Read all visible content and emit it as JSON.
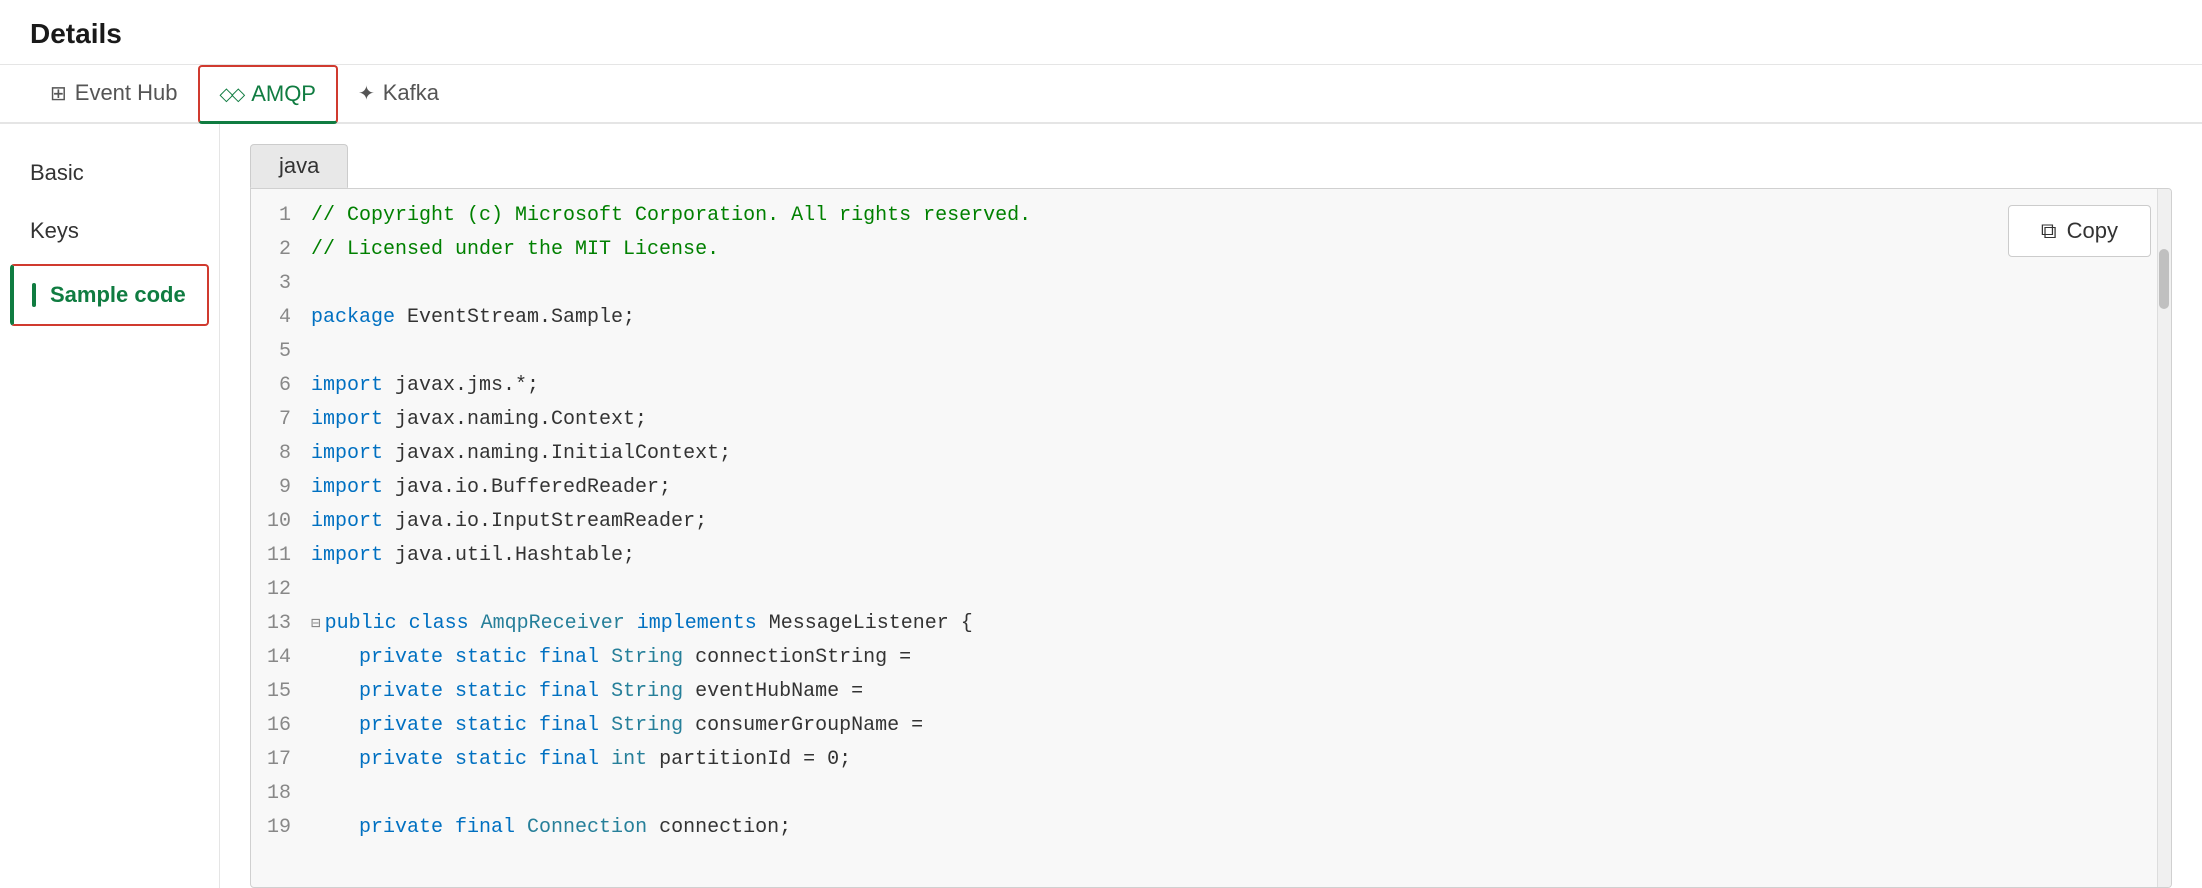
{
  "page": {
    "title": "Details"
  },
  "tabs": [
    {
      "id": "eventhub",
      "label": "Event Hub",
      "icon": "⊞",
      "active": false
    },
    {
      "id": "amqp",
      "label": "AMQP",
      "icon": "◇◇",
      "active": true,
      "bordered": true
    },
    {
      "id": "kafka",
      "label": "Kafka",
      "icon": "✦",
      "active": false
    }
  ],
  "sidebar": {
    "items": [
      {
        "id": "basic",
        "label": "Basic",
        "active": false
      },
      {
        "id": "keys",
        "label": "Keys",
        "active": false
      },
      {
        "id": "sample-code",
        "label": "Sample code",
        "active": true
      }
    ]
  },
  "code_panel": {
    "language_tab": "java",
    "copy_button_label": "Copy",
    "copy_icon": "⧉",
    "lines": [
      {
        "num": 1,
        "content": "// Copyright (c) Microsoft Corporation. All rights reserved.",
        "type": "comment"
      },
      {
        "num": 2,
        "content": "// Licensed under the MIT License.",
        "type": "comment"
      },
      {
        "num": 3,
        "content": "",
        "type": "text"
      },
      {
        "num": 4,
        "content": "package EventStream.Sample;",
        "type": "mixed",
        "parts": [
          {
            "text": "package ",
            "cls": "c-keyword"
          },
          {
            "text": "EventStream.Sample;",
            "cls": "c-text"
          }
        ]
      },
      {
        "num": 5,
        "content": "",
        "type": "text"
      },
      {
        "num": 6,
        "content": "import javax.jms.*;",
        "type": "mixed",
        "parts": [
          {
            "text": "import ",
            "cls": "c-keyword"
          },
          {
            "text": "javax.jms.*;",
            "cls": "c-text"
          }
        ]
      },
      {
        "num": 7,
        "content": "import javax.naming.Context;",
        "type": "mixed",
        "parts": [
          {
            "text": "import ",
            "cls": "c-keyword"
          },
          {
            "text": "javax.naming.Context;",
            "cls": "c-text"
          }
        ]
      },
      {
        "num": 8,
        "content": "import javax.naming.InitialContext;",
        "type": "mixed",
        "parts": [
          {
            "text": "import ",
            "cls": "c-keyword"
          },
          {
            "text": "javax.naming.InitialContext;",
            "cls": "c-text"
          }
        ]
      },
      {
        "num": 9,
        "content": "import java.io.BufferedReader;",
        "type": "mixed",
        "parts": [
          {
            "text": "import ",
            "cls": "c-keyword"
          },
          {
            "text": "java.io.BufferedReader;",
            "cls": "c-text"
          }
        ]
      },
      {
        "num": 10,
        "content": "import java.io.InputStreamReader;",
        "type": "mixed",
        "parts": [
          {
            "text": "import ",
            "cls": "c-keyword"
          },
          {
            "text": "java.io.InputStreamReader;",
            "cls": "c-text"
          }
        ]
      },
      {
        "num": 11,
        "content": "import java.util.Hashtable;",
        "type": "mixed",
        "parts": [
          {
            "text": "import ",
            "cls": "c-keyword"
          },
          {
            "text": "java.util.Hashtable;",
            "cls": "c-text"
          }
        ]
      },
      {
        "num": 12,
        "content": "",
        "type": "text"
      },
      {
        "num": 13,
        "content": "⊟ public class AmqpReceiver implements MessageListener {",
        "type": "class_decl",
        "collapse": true,
        "parts": [
          {
            "text": "public ",
            "cls": "c-keyword"
          },
          {
            "text": "class ",
            "cls": "c-keyword"
          },
          {
            "text": "AmqpReceiver ",
            "cls": "c-class"
          },
          {
            "text": "implements ",
            "cls": "c-keyword"
          },
          {
            "text": "MessageListener {",
            "cls": "c-text"
          }
        ]
      },
      {
        "num": 14,
        "content": "    private static final String connectionString =",
        "type": "mixed",
        "parts": [
          {
            "text": "    "
          },
          {
            "text": "private ",
            "cls": "c-keyword"
          },
          {
            "text": "static ",
            "cls": "c-keyword"
          },
          {
            "text": "final ",
            "cls": "c-keyword"
          },
          {
            "text": "String ",
            "cls": "c-type"
          },
          {
            "text": "connectionString =",
            "cls": "c-text"
          }
        ]
      },
      {
        "num": 15,
        "content": "    private static final String eventHubName =",
        "type": "mixed",
        "parts": [
          {
            "text": "    "
          },
          {
            "text": "private ",
            "cls": "c-keyword"
          },
          {
            "text": "static ",
            "cls": "c-keyword"
          },
          {
            "text": "final ",
            "cls": "c-keyword"
          },
          {
            "text": "String ",
            "cls": "c-type"
          },
          {
            "text": "eventHubName =",
            "cls": "c-text"
          }
        ]
      },
      {
        "num": 16,
        "content": "    private static final String consumerGroupName =",
        "type": "mixed",
        "parts": [
          {
            "text": "    "
          },
          {
            "text": "private ",
            "cls": "c-keyword"
          },
          {
            "text": "static ",
            "cls": "c-keyword"
          },
          {
            "text": "final ",
            "cls": "c-keyword"
          },
          {
            "text": "String ",
            "cls": "c-type"
          },
          {
            "text": "consumerGroupName =",
            "cls": "c-text"
          }
        ]
      },
      {
        "num": 17,
        "content": "    private static final int partitionId = 0;",
        "type": "mixed",
        "parts": [
          {
            "text": "    "
          },
          {
            "text": "private ",
            "cls": "c-keyword"
          },
          {
            "text": "static ",
            "cls": "c-keyword"
          },
          {
            "text": "final ",
            "cls": "c-keyword"
          },
          {
            "text": "int ",
            "cls": "c-type"
          },
          {
            "text": "partitionId = 0;",
            "cls": "c-text"
          }
        ]
      },
      {
        "num": 18,
        "content": "",
        "type": "text"
      },
      {
        "num": 19,
        "content": "    private final Connection connection;",
        "type": "mixed",
        "parts": [
          {
            "text": "    "
          },
          {
            "text": "private ",
            "cls": "c-keyword"
          },
          {
            "text": "final ",
            "cls": "c-keyword"
          },
          {
            "text": "Connection ",
            "cls": "c-type"
          },
          {
            "text": "connection;",
            "cls": "c-text"
          }
        ]
      }
    ]
  },
  "colors": {
    "accent_green": "#107c41",
    "border_red": "#d03a2f",
    "keyword_blue": "#0070c1",
    "type_teal": "#267f99",
    "comment_green": "#008000",
    "line_number_gray": "#888888"
  }
}
